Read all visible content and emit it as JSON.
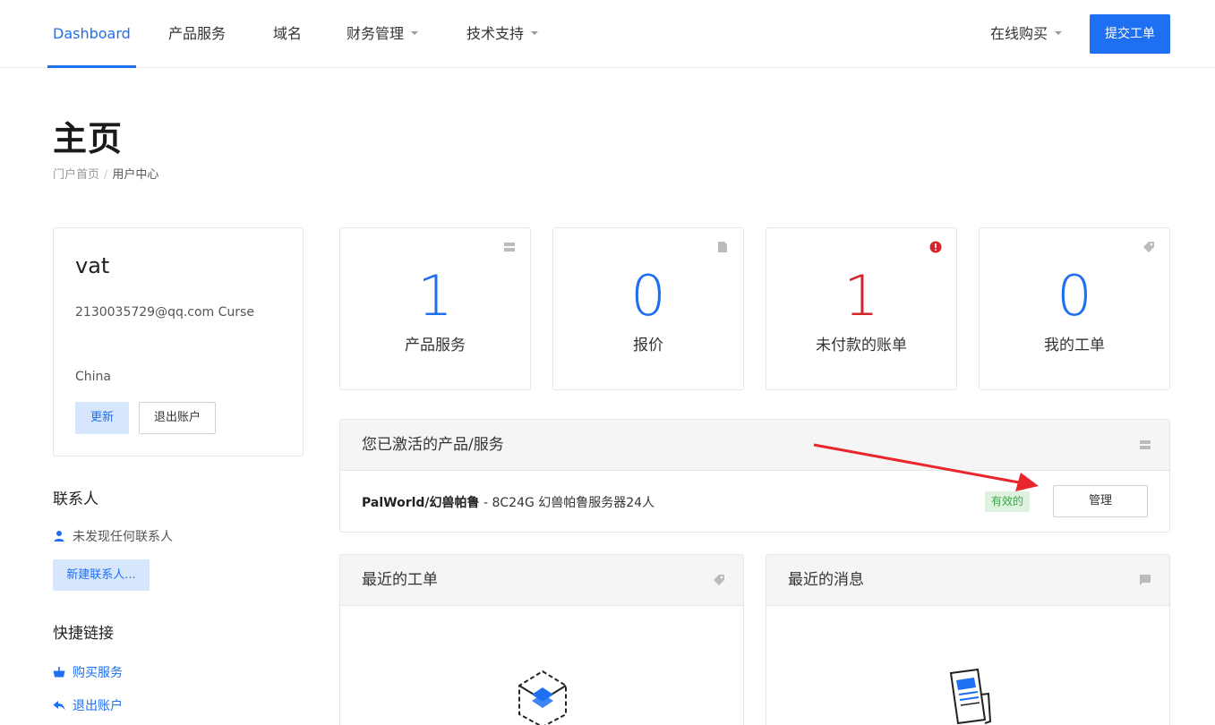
{
  "nav": {
    "items": [
      {
        "label": "Dashboard",
        "active": true,
        "dropdown": false
      },
      {
        "label": "产品服务",
        "active": false,
        "dropdown": false
      },
      {
        "label": "域名",
        "active": false,
        "dropdown": false
      },
      {
        "label": "财务管理",
        "active": false,
        "dropdown": true
      },
      {
        "label": "技术支持",
        "active": false,
        "dropdown": true
      }
    ],
    "online_buy": "在线购买",
    "submit_ticket": "提交工单",
    "accent_color": "#1e6ff1"
  },
  "header": {
    "title": "主页",
    "breadcrumb": [
      "门户首页",
      "用户中心"
    ],
    "breadcrumb_sep": "/"
  },
  "profile": {
    "name": "vat",
    "email": "2130035729@qq.com Curse",
    "country": "China",
    "update_label": "更新",
    "logout_label": "退出账户"
  },
  "contacts": {
    "heading": "联系人",
    "empty_text": "未发现任何联系人",
    "new_label": "新建联系人..."
  },
  "quick_links": {
    "heading": "快捷链接",
    "items": [
      {
        "label": "购买服务",
        "icon": "basket-icon"
      },
      {
        "label": "退出账户",
        "icon": "back-arrow-icon"
      }
    ]
  },
  "stats": [
    {
      "value": "1",
      "label": "产品服务",
      "icon": "server-icon",
      "color": "#1e6ff1"
    },
    {
      "value": "0",
      "label": "报价",
      "icon": "file-icon",
      "color": "#1e6ff1"
    },
    {
      "value": "1",
      "label": "未付款的账单",
      "icon": "alert-circle-icon",
      "color": "#d6242d"
    },
    {
      "value": "0",
      "label": "我的工单",
      "icon": "tag-icon",
      "color": "#1e6ff1"
    }
  ],
  "active_services": {
    "title": "您已激活的产品/服务",
    "service_name": "PalWorld/幻兽帕鲁",
    "service_detail": " - 8C24G 幻兽帕鲁服务器24人",
    "status": "有效的",
    "manage_label": "管理"
  },
  "recent_tickets": {
    "title": "最近的工单"
  },
  "recent_news": {
    "title": "最近的消息"
  }
}
